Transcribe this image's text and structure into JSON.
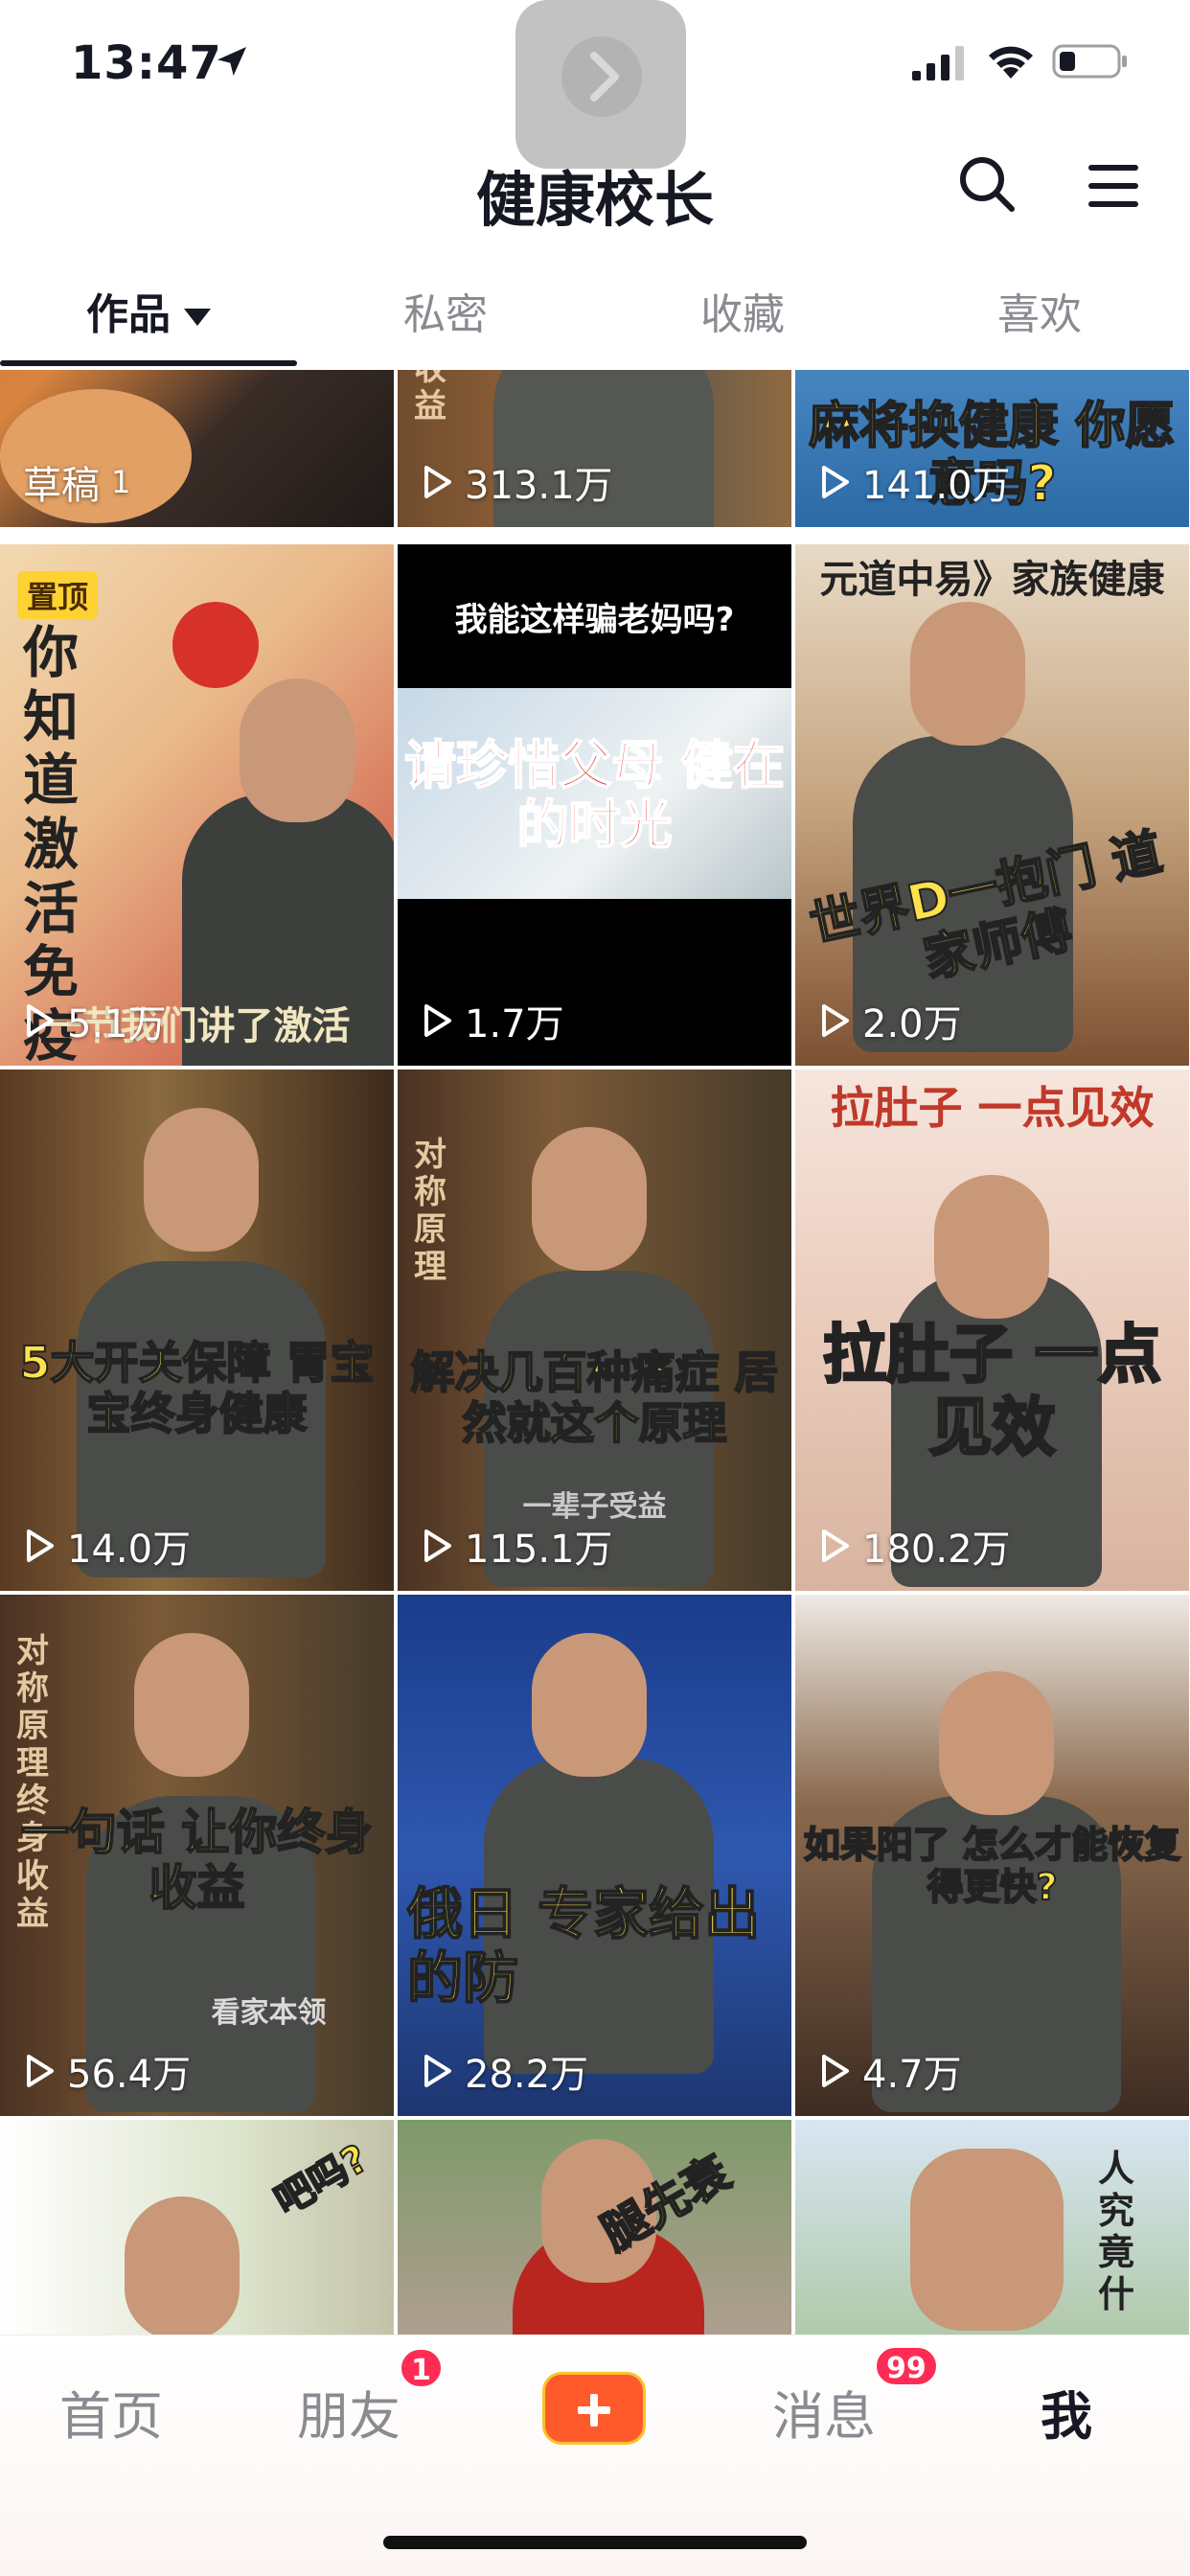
{
  "status_bar": {
    "time": "13:47"
  },
  "header": {
    "title": "健康校长"
  },
  "tabs": [
    {
      "label": "作品",
      "active": true
    },
    {
      "label": "私密",
      "active": false
    },
    {
      "label": "收藏",
      "active": false
    },
    {
      "label": "喜欢",
      "active": false
    }
  ],
  "videos": [
    {
      "label": "草稿",
      "count": "1",
      "caption": ""
    },
    {
      "views": "313.1万",
      "caption": "收益"
    },
    {
      "views": "141.0万",
      "caption": "麻将换健康 你愿意吗?"
    },
    {
      "views": "5.1万",
      "pinned": "置顶",
      "caption": "你知道激活免疫 黑科技吗?",
      "subcaption": "一节我们讲了激活"
    },
    {
      "views": "1.7万",
      "caption": "请珍惜父母 健在的时光",
      "top_text": "我能这样骗老妈吗?"
    },
    {
      "views": "2.0万",
      "caption": "世界D一抱门 道家师傅",
      "top_text": "元道中易》家族健康"
    },
    {
      "views": "14.0万",
      "caption": "5大开关保障 胃宝宝终身健康"
    },
    {
      "views": "115.1万",
      "caption": "解决几百种痛症 居然就这个原理",
      "side_text": "对称原理",
      "watermark": "一辈子受益"
    },
    {
      "views": "180.2万",
      "caption": "拉肚子 一点见效",
      "top_text": "拉肚子 一点见效"
    },
    {
      "views": "56.4万",
      "caption": "一句话 让你终身收益",
      "side_text": "对称原理 终身收益",
      "watermark": "看家本领"
    },
    {
      "views": "28.2万",
      "caption": "俄日 专家给出的防"
    },
    {
      "views": "4.7万",
      "caption": "如果阳了 怎么才能恢复得更快?"
    },
    {
      "caption": "吧吗?"
    },
    {
      "caption": "腿先衰"
    },
    {
      "caption": "人究竟什"
    }
  ],
  "bottom_nav": {
    "home": "首页",
    "friends": "朋友",
    "friends_badge": "1",
    "messages": "消息",
    "messages_badge": "99",
    "me": "我"
  },
  "colors": {
    "accent": "#fe2c55",
    "plus": "#fe5a2c",
    "caption_yellow": "#ffe24a"
  }
}
